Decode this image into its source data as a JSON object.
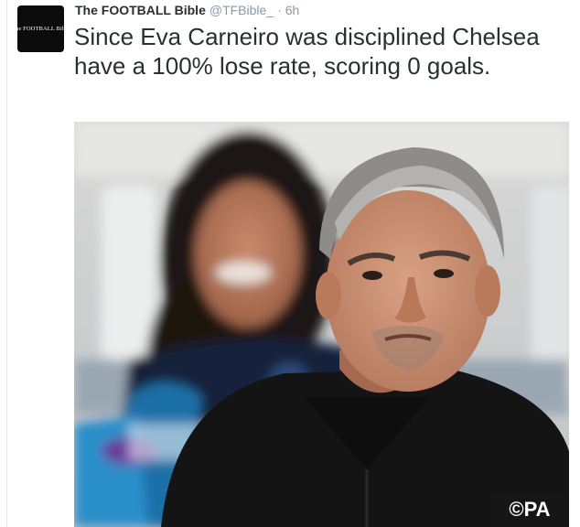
{
  "tweet": {
    "avatar_text": "The FOOTBALL Bible",
    "author_name": "The FOOTBALL Bible",
    "author_handle": "@TFBible_",
    "separator": "·",
    "timestamp": "6h",
    "text": "Since Eva Carneiro was disciplined Chelsea have a 100% lose rate, scoring 0 goals."
  },
  "photo": {
    "credit": "©PA"
  },
  "colors": {
    "name": "#292f33",
    "meta": "#8899a6",
    "avatar_bg": "#0b0b0b"
  }
}
